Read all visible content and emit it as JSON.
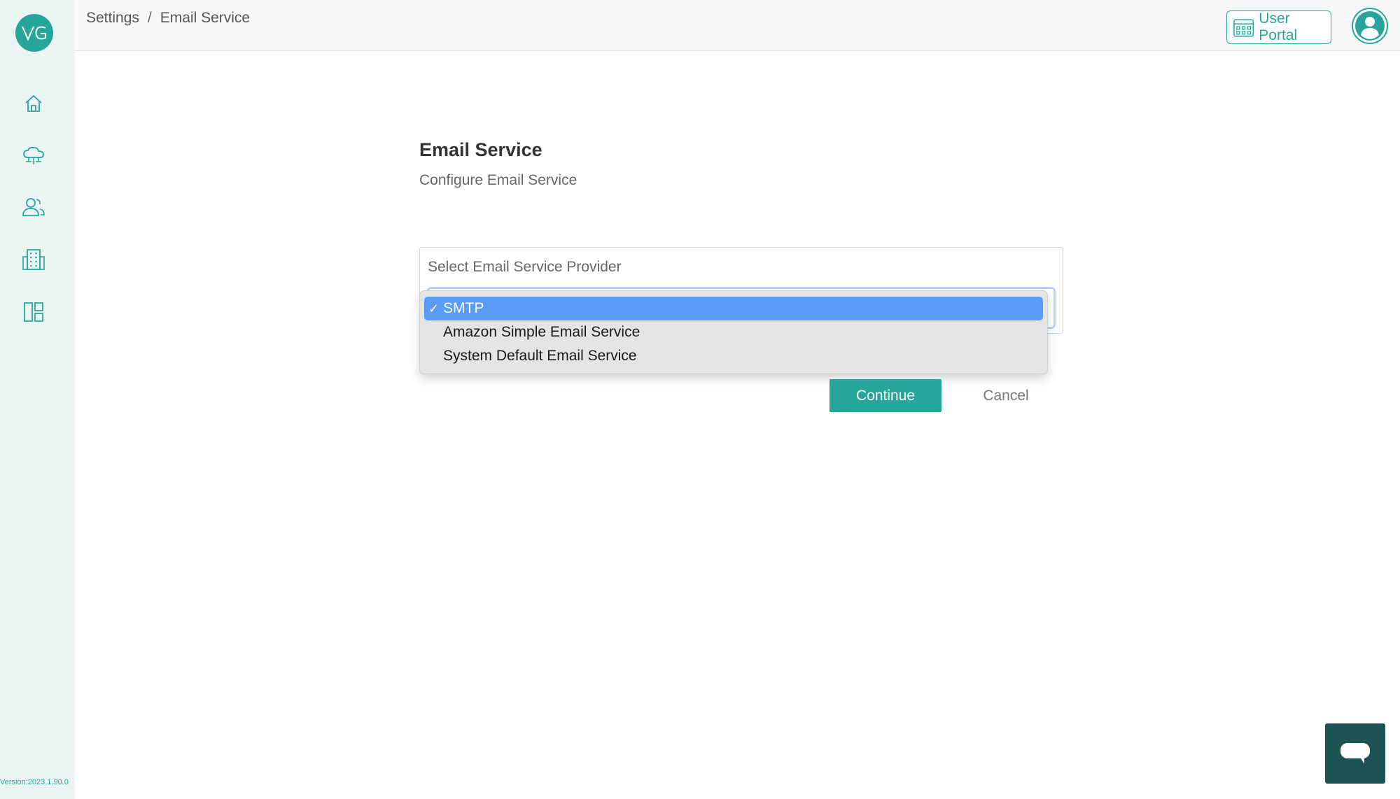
{
  "sidebar": {
    "logo_text": "VG",
    "items": [
      {
        "icon": "home-icon"
      },
      {
        "icon": "cloud-network-icon"
      },
      {
        "icon": "users-icon"
      },
      {
        "icon": "building-icon"
      },
      {
        "icon": "dashboard-layout-icon"
      }
    ],
    "version": "Version:2023.1.90.0"
  },
  "header": {
    "breadcrumb": [
      "Settings",
      "/",
      "Email Service"
    ],
    "user_portal_label": "User Portal"
  },
  "main": {
    "title": "Email Service",
    "subtitle": "Configure Email Service",
    "provider_label": "Select Email Service Provider",
    "dropdown_options": [
      {
        "label": "SMTP",
        "selected": true,
        "check": "✓"
      },
      {
        "label": "Amazon Simple Email Service",
        "selected": false
      },
      {
        "label": "System Default Email Service",
        "selected": false
      }
    ],
    "continue_label": "Continue",
    "cancel_label": "Cancel"
  },
  "colors": {
    "accent": "#26a69a",
    "sidebar_bg": "#eaf4f2",
    "selected_option": "#5a9cf5",
    "chat_button": "#1e5356"
  }
}
